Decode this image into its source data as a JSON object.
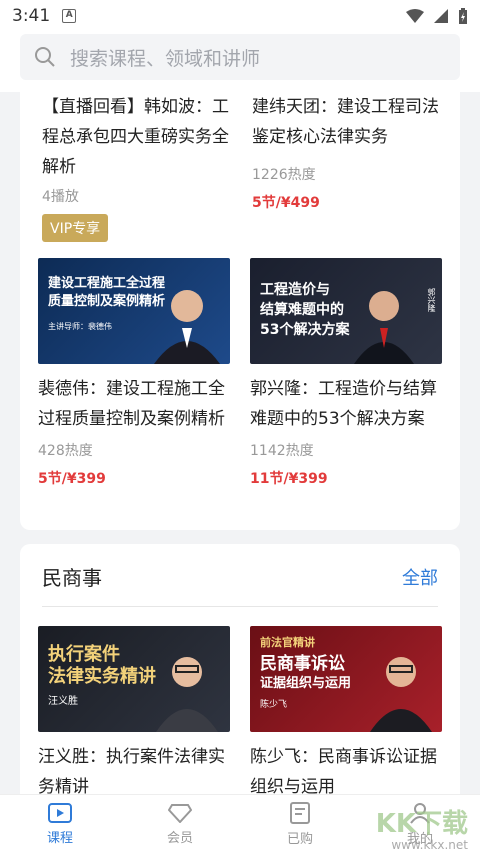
{
  "status": {
    "time": "3:41"
  },
  "search": {
    "placeholder": "搜索课程、领域和讲师"
  },
  "section1": {
    "courses": [
      {
        "title": "【直播回看】韩如波：工程总承包四大重磅实务全解析",
        "meta": "4播放",
        "badge": "VIP专享"
      },
      {
        "title": "建纬天团：建设工程司法鉴定核心法律实务",
        "meta": "1226热度",
        "price": "5节/¥499"
      },
      {
        "title": "裴德伟：建设工程施工全过程质量控制及案例精析",
        "meta": "428热度",
        "price": "5节/¥399",
        "thumb": {
          "line1": "建设工程施工全过程",
          "line2": "质量控制及案例精析",
          "speaker": "主讲导师：裴德伟"
        }
      },
      {
        "title": "郭兴隆：工程造价与结算难题中的53个解决方案",
        "meta": "1142热度",
        "price": "11节/¥399",
        "thumb": {
          "line1": "工程造价与",
          "line2": "结算难题中的",
          "line3": "53个解决方案",
          "seal": "郭兴隆"
        }
      }
    ]
  },
  "section2": {
    "title": "民商事",
    "all_label": "全部",
    "courses": [
      {
        "title": "汪义胜：执行案件法律实务精讲",
        "thumb": {
          "line1": "执行案件",
          "line2": "法律实务精讲",
          "seal": "汪义胜"
        }
      },
      {
        "title": "陈少飞：民商事诉讼证据组织与运用",
        "thumb": {
          "tag": "前法官精讲",
          "line1": "民商事诉讼",
          "line2": "证据组织与运用",
          "seal": "陈少飞"
        }
      }
    ]
  },
  "tabbar": [
    {
      "label": "课程",
      "icon": "course-play-icon",
      "active": true
    },
    {
      "label": "会员",
      "icon": "member-diamond-icon"
    },
    {
      "label": "已购",
      "icon": "purchased-list-icon"
    },
    {
      "label": "我的",
      "icon": "profile-icon"
    }
  ],
  "watermark": {
    "logo": "KK下载",
    "url": "www.kkx.net"
  },
  "colors": {
    "accent": "#2f7bd8",
    "price": "#e23b3b",
    "vip": "#c9a95a"
  }
}
